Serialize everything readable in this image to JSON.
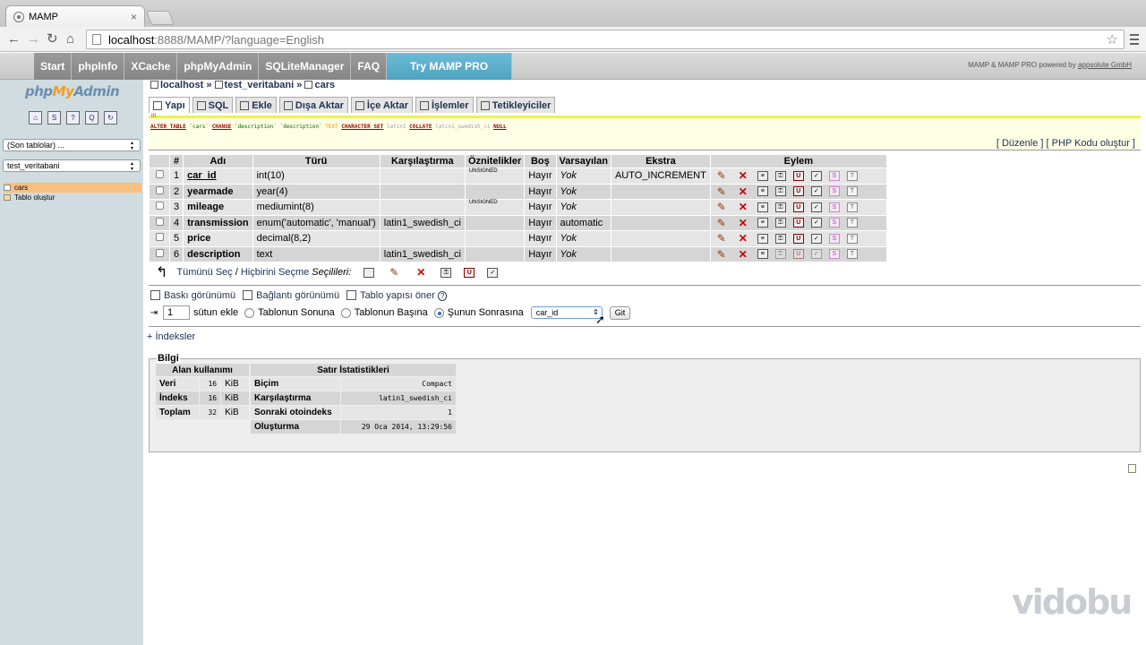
{
  "browser": {
    "tab_title": "MAMP",
    "tab_close": "×",
    "url_host": "localhost",
    "url_path": ":8888/MAMP/?language=English"
  },
  "mamp": {
    "nav": [
      "Start",
      "phpInfo",
      "XCache",
      "phpMyAdmin",
      "SQLiteManager",
      "FAQ"
    ],
    "try_pro": "Try MAMP PRO",
    "powered_by": "MAMP & MAMP PRO powered by",
    "powered_link": "appsolute GmbH"
  },
  "left": {
    "logo_php": "php",
    "logo_my": "My",
    "logo_admin": "Admin",
    "recent_select": "(Son tablolar) ...",
    "db_select": "test_veritabani",
    "tables": [
      "cars"
    ],
    "create_table": "Tablo oluştur"
  },
  "breadcrumb": {
    "server": "localhost",
    "database": "test_veritabani",
    "table": "cars",
    "sep": "»"
  },
  "tabs": [
    "Yapı",
    "SQL",
    "Ekle",
    "Dışa Aktar",
    "İçe Aktar",
    "İşlemler",
    "Tetikleyiciler"
  ],
  "sql": {
    "marker": "!!!",
    "parts": [
      "ALTER TABLE",
      "`cars`",
      "CHANGE",
      "`description`",
      "`description`",
      "TEXT",
      "CHARACTER SET",
      "latin1",
      "COLLATE",
      "latin1_swedish_ci",
      "NULL"
    ],
    "edit_link": "Düzenle",
    "php_link": "PHP Kodu oluştur"
  },
  "structure": {
    "headers": [
      "#",
      "Adı",
      "Türü",
      "Karşılaştırma",
      "Öznitelikler",
      "Boş",
      "Varsayılan",
      "Ekstra",
      "Eylem"
    ],
    "rows": [
      {
        "num": "1",
        "name": "car_id",
        "type": "int(10)",
        "collation": "",
        "attributes": "UNSIGNED",
        "null": "Hayır",
        "default": "Yok",
        "extra": "AUTO_INCREMENT"
      },
      {
        "num": "2",
        "name": "yearmade",
        "type": "year(4)",
        "collation": "",
        "attributes": "",
        "null": "Hayır",
        "default": "Yok",
        "extra": ""
      },
      {
        "num": "3",
        "name": "mileage",
        "type": "mediumint(8)",
        "collation": "",
        "attributes": "UNSIGNED",
        "null": "Hayır",
        "default": "Yok",
        "extra": ""
      },
      {
        "num": "4",
        "name": "transmission",
        "type": "enum('automatic', 'manual')",
        "collation": "latin1_swedish_ci",
        "attributes": "",
        "null": "Hayır",
        "default": "automatic",
        "extra": ""
      },
      {
        "num": "5",
        "name": "price",
        "type": "decimal(8,2)",
        "collation": "",
        "attributes": "",
        "null": "Hayır",
        "default": "Yok",
        "extra": ""
      },
      {
        "num": "6",
        "name": "description",
        "type": "text",
        "collation": "latin1_swedish_ci",
        "attributes": "",
        "null": "Hayır",
        "default": "Yok",
        "extra": ""
      }
    ],
    "select_all": "Tümünü Seç",
    "slash": "/",
    "select_none": "Hiçbirini Seçme",
    "with_selected": "Seçilileri:"
  },
  "tools": {
    "print_view": "Baskı görünümü",
    "relation_view": "Bağlantı görünümü",
    "propose": "Tablo yapısı öner",
    "help": "?"
  },
  "add_column": {
    "count": "1",
    "label": "sütun ekle",
    "opt_end": "Tablonun Sonuna",
    "opt_begin": "Tablonun Başına",
    "opt_after": "Şunun Sonrasına",
    "after_value": "car_id",
    "go": "Git"
  },
  "indexes": "+ İndeksler",
  "info": {
    "legend": "Bilgi",
    "space_header": "Alan kullanımı",
    "space_rows": [
      {
        "label": "Veri",
        "value": "16",
        "unit": "KiB"
      },
      {
        "label": "İndeks",
        "value": "16",
        "unit": "KiB"
      },
      {
        "label": "Toplam",
        "value": "32",
        "unit": "KiB"
      }
    ],
    "stats_header": "Satır İstatistikleri",
    "stats_rows": [
      {
        "label": "Biçim",
        "value": "Compact"
      },
      {
        "label": "Karşılaştırma",
        "value": "latin1_swedish_ci"
      },
      {
        "label": "Sonraki otoindeks",
        "value": "1"
      },
      {
        "label": "Oluşturma",
        "value": "29 Oca 2014, 13:29:56"
      }
    ]
  },
  "watermark": "vidobu"
}
